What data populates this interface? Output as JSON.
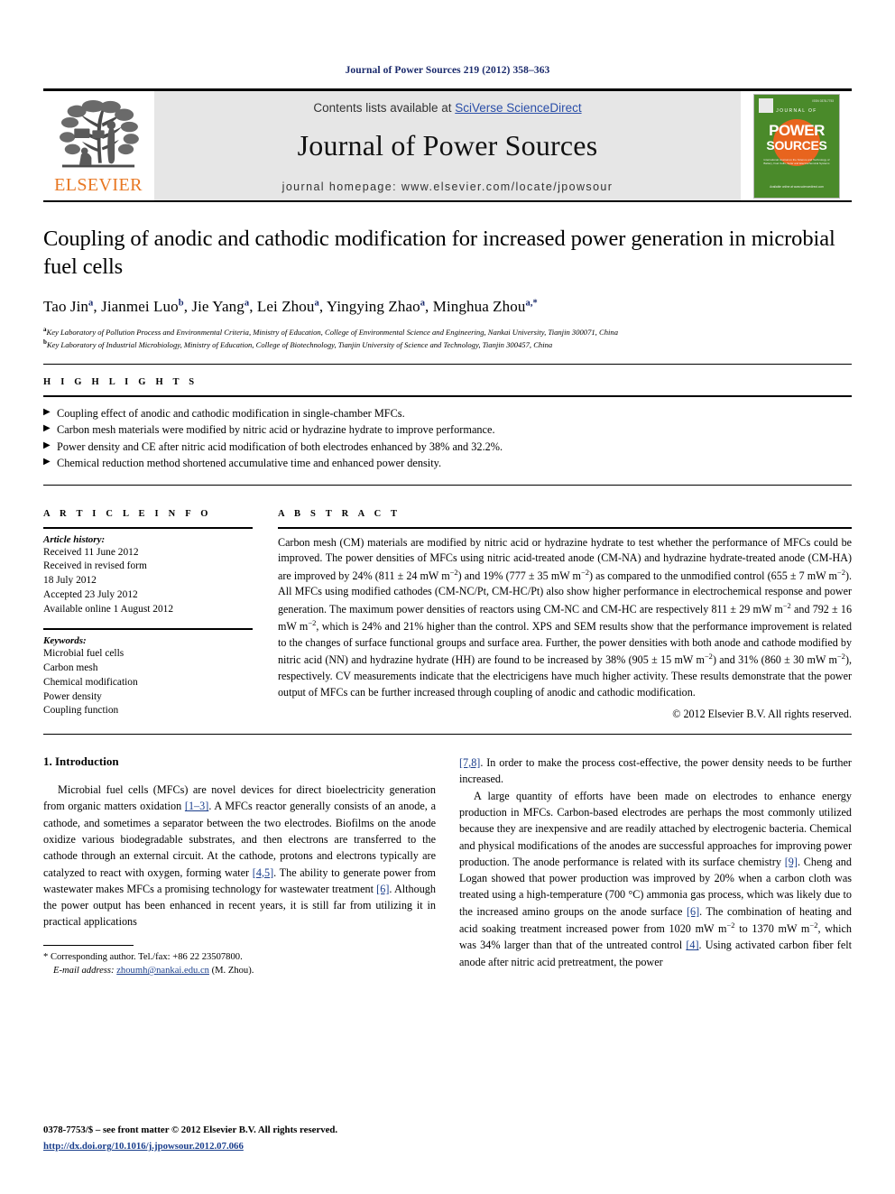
{
  "running_head": "Journal of Power Sources 219 (2012) 358–363",
  "masthead": {
    "contents_prefix": "Contents lists available at ",
    "contents_link": "SciVerse ScienceDirect",
    "journal_title": "Journal of Power Sources",
    "homepage": "journal homepage: www.elsevier.com/locate/jpowsour",
    "publisher_logo_text": "ELSEVIER",
    "cover": {
      "line_journal_of": "JOURNAL OF",
      "word_power": "POWER",
      "word_sources": "SOURCES",
      "subtitle": "International Journal on the Science and Technology of Battery, Fuel Cells, Solar and Electrochemical Systems",
      "footer": "Available online at\nwww.sciencedirect.com",
      "issn": "ISSN 0378-7753"
    }
  },
  "article": {
    "title": "Coupling of anodic and cathodic modification for increased power generation in microbial fuel cells",
    "authors": [
      {
        "name": "Tao Jin",
        "sup": "a"
      },
      {
        "name": "Jianmei Luo",
        "sup": "b"
      },
      {
        "name": "Jie Yang",
        "sup": "a"
      },
      {
        "name": "Lei Zhou",
        "sup": "a"
      },
      {
        "name": "Yingying Zhao",
        "sup": "a"
      },
      {
        "name": "Minghua Zhou",
        "sup": "a,*"
      }
    ],
    "affiliations": [
      {
        "sup": "a",
        "text": "Key Laboratory of Pollution Process and Environmental Criteria, Ministry of Education, College of Environmental Science and Engineering, Nankai University, Tianjin 300071, China"
      },
      {
        "sup": "b",
        "text": "Key Laboratory of Industrial Microbiology, Ministry of Education, College of Biotechnology, Tianjin University of Science and Technology, Tianjin 300457, China"
      }
    ]
  },
  "highlights": {
    "heading": "H I G H L I G H T S",
    "bullet_glyph": "▶",
    "items": [
      "Coupling effect of anodic and cathodic modification in single-chamber MFCs.",
      "Carbon mesh materials were modified by nitric acid or hydrazine hydrate to improve performance.",
      "Power density and CE after nitric acid modification of both electrodes enhanced by 38% and 32.2%.",
      "Chemical reduction method shortened accumulative time and enhanced power density."
    ]
  },
  "article_info": {
    "heading": "A R T I C L E   I N F O",
    "history_label": "Article history:",
    "history": [
      "Received 11 June 2012",
      "Received in revised form",
      "18 July 2012",
      "Accepted 23 July 2012",
      "Available online 1 August 2012"
    ],
    "keywords_label": "Keywords:",
    "keywords": [
      "Microbial fuel cells",
      "Carbon mesh",
      "Chemical modification",
      "Power density",
      "Coupling function"
    ]
  },
  "abstract": {
    "heading": "A B S T R A C T",
    "paragraph_part1": "Carbon mesh (CM) materials are modified by nitric acid or hydrazine hydrate to test whether the performance of MFCs could be improved. The power densities of MFCs using nitric acid-treated anode (CM-NA) and hydrazine hydrate-treated anode (CM-HA) are improved by 24% (811 ± 24 mW m",
    "paragraph_part2": ") and 19% (777 ± 35 mW m",
    "paragraph_part3": ") as compared to the unmodified control (655 ± 7 mW m",
    "paragraph_part4": "). All MFCs using modified cathodes (CM-NC/Pt, CM-HC/Pt) also show higher performance in electrochemical response and power generation. The maximum power densities of reactors using CM-NC and CM-HC are respectively 811 ± 29 mW m",
    "paragraph_part5": " and 792 ± 16 mW m",
    "paragraph_part6": ", which is 24% and 21% higher than the control. XPS and SEM results show that the performance improvement is related to the changes of surface functional groups and surface area. Further, the power densities with both anode and cathode modified by nitric acid (NN) and hydrazine hydrate (HH) are found to be increased by 38% (905 ± 15 mW m",
    "paragraph_part7": ") and 31% (860 ± 30 mW m",
    "paragraph_part8": "), respectively. CV measurements indicate that the electricigens have much higher activity. These results demonstrate that the power output of MFCs can be further increased through coupling of anodic and cathodic modification.",
    "superscript": "−2",
    "copyright": "© 2012 Elsevier B.V. All rights reserved."
  },
  "body": {
    "section_heading": "1. Introduction",
    "left_p1_a": "Microbial fuel cells (MFCs) are novel devices for direct bioelectricity generation from organic matters oxidation ",
    "left_ref1": "[1–3]",
    "left_p1_b": ". A MFCs reactor generally consists of an anode, a cathode, and sometimes a separator between the two electrodes. Biofilms on the anode oxidize various biodegradable substrates, and then electrons are transferred to the cathode through an external circuit. At the cathode, protons and electrons typically are catalyzed to react with oxygen, forming water ",
    "left_ref2": "[4,5]",
    "left_p1_c": ". The ability to generate power from wastewater makes MFCs a promising technology for wastewater treatment ",
    "left_ref3": "[6]",
    "left_p1_d": ". Although the power output has been enhanced in recent years, it is still far from utilizing it in practical applications ",
    "right_ref1": "[7,8]",
    "right_p1": ". In order to make the process cost-effective, the power density needs to be further increased.",
    "right_p2_a": "A large quantity of efforts have been made on electrodes to enhance energy production in MFCs. Carbon-based electrodes are perhaps the most commonly utilized because they are inexpensive and are readily attached by electrogenic bacteria. Chemical and physical modifications of the anodes are successful approaches for improving power production. The anode performance is related with its surface chemistry ",
    "right_ref2": "[9]",
    "right_p2_b": ". Cheng and Logan showed that power production was improved by 20% when a carbon cloth was treated using a high-temperature (700 °C) ammonia gas process, which was likely due to the increased amino groups on the anode surface ",
    "right_ref3": "[6]",
    "right_p2_c": ". The combination of heating and acid soaking treatment increased power from 1020 mW m",
    "right_p2_d": " to 1370 mW m",
    "right_p2_e": ", which was 34% larger than that of the untreated control ",
    "right_ref4": "[4]",
    "right_p2_f": ". Using activated carbon fiber felt anode after nitric acid pretreatment, the power",
    "superscript": "−2"
  },
  "footnote": {
    "star": "*",
    "corresponding": " Corresponding author. Tel./fax: +86 22 23507800.",
    "email_label": "E-mail address:",
    "email": "zhoumh@nankai.edu.cn",
    "email_suffix": " (M. Zhou)."
  },
  "footer": {
    "issn_line": "0378-7753/$ – see front matter © 2012 Elsevier B.V. All rights reserved.",
    "doi": "http://dx.doi.org/10.1016/j.jpowsour.2012.07.066"
  },
  "colors": {
    "link_blue": "#1a3e8c",
    "elsevier_orange": "#E87722",
    "cover_green": "#4a8a2a",
    "band_gray": "#e6e6e6"
  }
}
